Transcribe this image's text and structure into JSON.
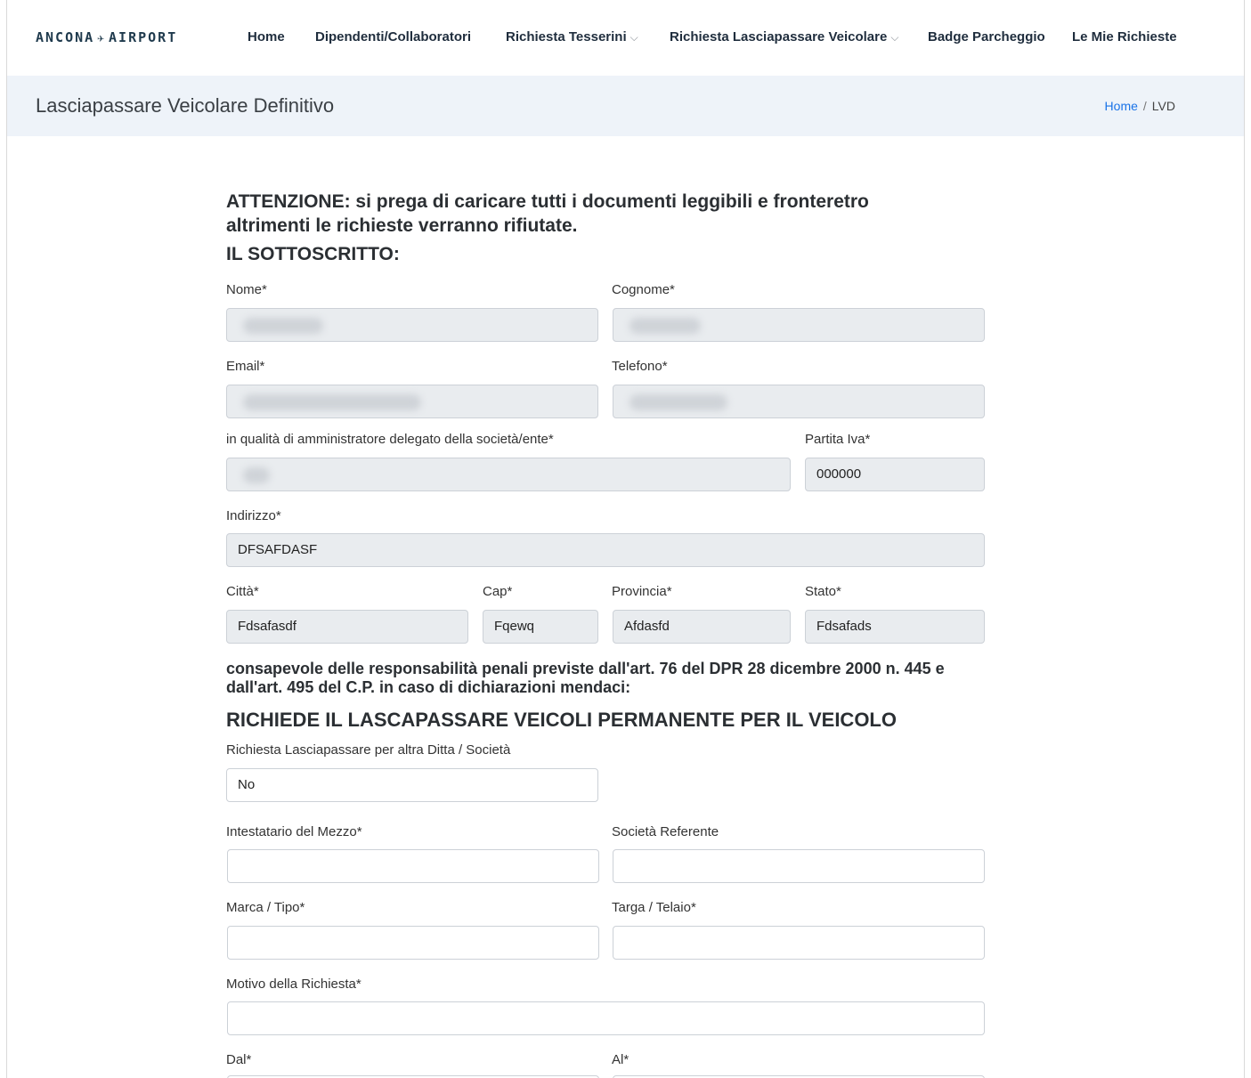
{
  "header": {
    "logo_left": "ANCONA",
    "logo_plane": "✈",
    "logo_right": "AIRPORT",
    "nav": [
      {
        "label": "Home",
        "dropdown": false
      },
      {
        "label": "Dipendenti/Collaboratori",
        "dropdown": false
      },
      {
        "label": "Richiesta Tesserini",
        "dropdown": true
      },
      {
        "label": "Richiesta Lasciapassare Veicolare",
        "dropdown": true
      },
      {
        "label": "Badge Parcheggio",
        "dropdown": false
      },
      {
        "label": "Le Mie Richieste",
        "dropdown": false
      }
    ],
    "chevron": "⌵"
  },
  "titlebar": {
    "title": "Lasciapassare Veicolare Definitivo",
    "breadcrumb_home": "Home",
    "breadcrumb_sep": "/",
    "breadcrumb_current": "LVD"
  },
  "form": {
    "warning": "ATTENZIONE: si prega di caricare tutti i documenti leggibili e fronteretro altrimenti le richieste verranno rifiutate.",
    "section1_title": "IL SOTTOSCRITTO:",
    "nome_label": "Nome*",
    "cognome_label": "Cognome*",
    "email_label": "Email*",
    "telefono_label": "Telefono*",
    "ruolo_label": "in qualità di amministratore delegato della società/ente*",
    "piva_label": "Partita Iva*",
    "piva_value": "000000",
    "indirizzo_label": "Indirizzo*",
    "indirizzo_value": "DFSAFDASF",
    "citta_label": "Città*",
    "citta_value": "Fdsafasdf",
    "cap_label": "Cap*",
    "cap_value": "Fqewq",
    "provincia_label": "Provincia*",
    "provincia_value": "Afdasfd",
    "stato_label": "Stato*",
    "stato_value": "Fdsafads",
    "declaration": "consapevole delle responsabilità penali previste dall'art. 76 del DPR 28 dicembre 2000 n. 445 e dall'art. 495 del C.P. in caso di dichiarazioni mendaci:",
    "section2_title": "RICHIEDE IL LASCAPASSARE VEICOLI PERMANENTE PER IL VEICOLO",
    "altra_ditta_label": "Richiesta Lasciapassare per altra Ditta / Società",
    "altra_ditta_value": "No",
    "intestatario_label": "Intestatario del Mezzo*",
    "societa_ref_label": "Società Referente",
    "marca_label": "Marca / Tipo*",
    "targa_label": "Targa / Telaio*",
    "motivo_label": "Motivo della Richiesta*",
    "dal_label": "Dal*",
    "al_label": "Al*"
  }
}
